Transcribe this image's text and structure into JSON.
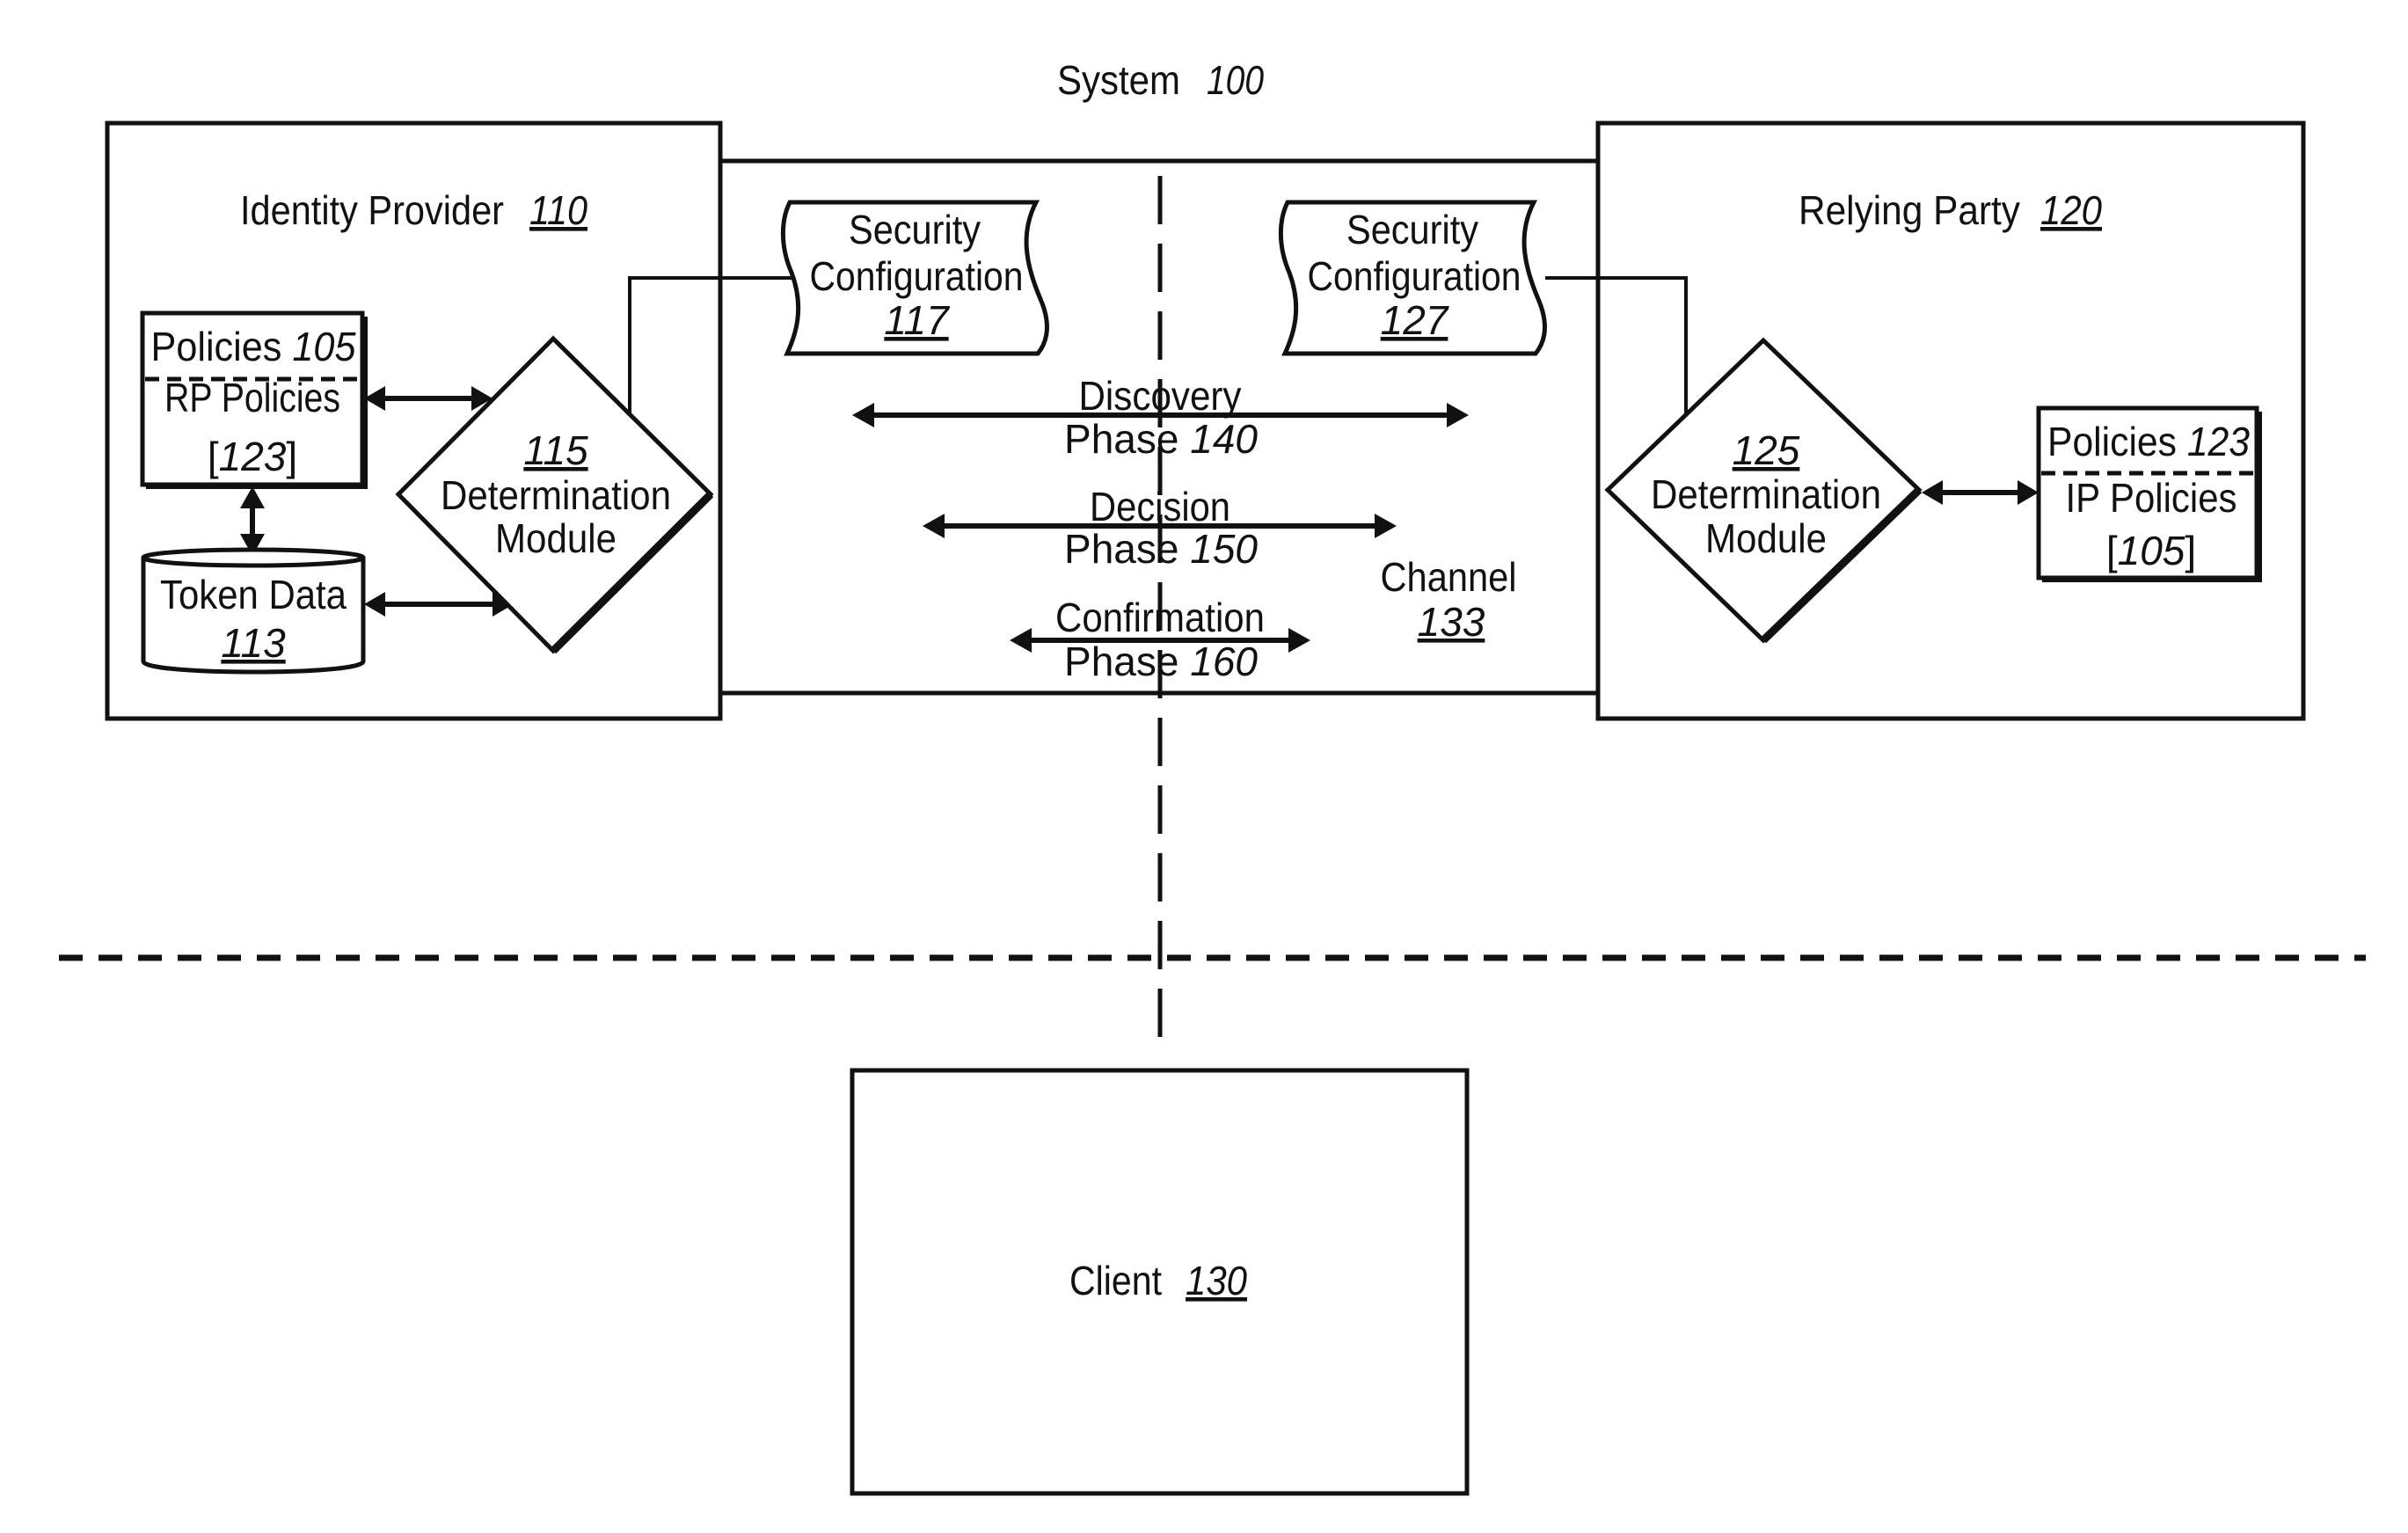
{
  "figure": {
    "title": "System",
    "title_ref": "100"
  },
  "identity_provider": {
    "label": "Identity Provider",
    "ref": "110",
    "policies": {
      "title": "Policies",
      "title_ref": "105",
      "sub_label": "RP Policies",
      "sub_ref_open": "[",
      "sub_ref": "123",
      "sub_ref_close": "]"
    },
    "token_data": {
      "label": "Token Data",
      "ref": "113"
    },
    "determination_module": {
      "ref": "115",
      "line1": "Determination",
      "line2": "Module"
    },
    "security_configuration": {
      "line1": "Security",
      "line2": "Configuration",
      "ref": "117"
    }
  },
  "relying_party": {
    "label": "Relying Party",
    "ref": "120",
    "policies": {
      "title": "Policies",
      "title_ref": "123",
      "sub_label": "IP Policies",
      "sub_ref_open": "[",
      "sub_ref": "105",
      "sub_ref_close": "]"
    },
    "determination_module": {
      "ref": "125",
      "line1": "Determination",
      "line2": "Module"
    },
    "security_configuration": {
      "line1": "Security",
      "line2": "Configuration",
      "ref": "127"
    }
  },
  "channel": {
    "label": "Channel",
    "ref": "133",
    "phases": [
      {
        "name": "Discovery",
        "label": "Phase",
        "ref": "140"
      },
      {
        "name": "Decision",
        "label": "Phase",
        "ref": "150"
      },
      {
        "name": "Confirmation",
        "label": "Phase",
        "ref": "160"
      }
    ]
  },
  "client": {
    "label": "Client",
    "ref": "130"
  },
  "colors": {
    "line": "#111111",
    "background": "#ffffff"
  }
}
